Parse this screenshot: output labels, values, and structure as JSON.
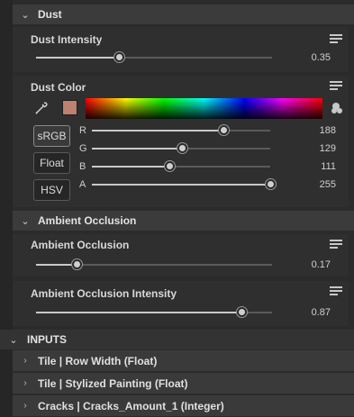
{
  "dust": {
    "header": "Dust",
    "intensity": {
      "label": "Dust Intensity",
      "value": "0.35",
      "fraction": 0.35
    },
    "color": {
      "label": "Dust Color",
      "swatch": "#bc8170",
      "modes": [
        "sRGB",
        "Float",
        "HSV"
      ],
      "active_mode": "sRGB",
      "channels": [
        {
          "name": "R",
          "value": "188",
          "fraction": 0.737
        },
        {
          "name": "G",
          "value": "129",
          "fraction": 0.506
        },
        {
          "name": "B",
          "value": "111",
          "fraction": 0.435
        },
        {
          "name": "A",
          "value": "255",
          "fraction": 1.0
        }
      ]
    }
  },
  "ambient_occlusion": {
    "header": "Ambient Occlusion",
    "ao": {
      "label": "Ambient Occlusion",
      "value": "0.17",
      "fraction": 0.17
    },
    "ao_intensity": {
      "label": "Ambient Occlusion Intensity",
      "value": "0.87",
      "fraction": 0.87
    }
  },
  "inputs": {
    "header": "INPUTS",
    "items": [
      "Tile | Row Width (Float)",
      "Tile | Stylized Painting (Float)",
      "Cracks | Cracks_Amount_1 (Integer)"
    ]
  },
  "icons": {
    "collapse": "chevron-down-icon",
    "expand": "chevron-right-icon",
    "menu": "menu-icon",
    "picker": "eyedropper-icon",
    "palette": "palette-icon"
  }
}
